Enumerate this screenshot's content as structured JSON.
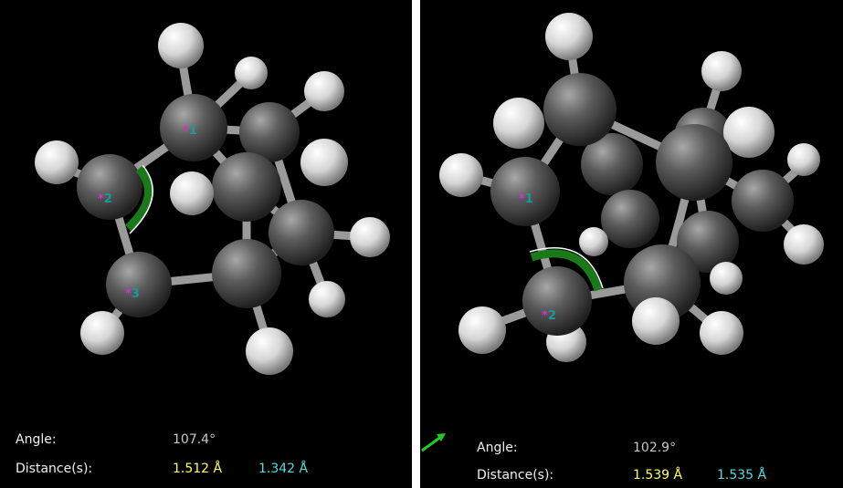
{
  "left_view": {
    "atom_labels": [
      "1",
      "2",
      "3"
    ],
    "angle_label": "Angle:",
    "angle_value": "107.4°",
    "distance_label": "Distance(s):",
    "distance_1": "1.512 Å",
    "distance_2": "1.342 Å"
  },
  "right_view": {
    "atom_labels": [
      "1",
      "2"
    ],
    "angle_label": "Angle:",
    "angle_value": "102.9°",
    "distance_label": "Distance(s):",
    "distance_1": "1.539 Å",
    "distance_2": "1.535 Å"
  },
  "colors": {
    "background": "#000000",
    "carbon": "#555555",
    "hydrogen": "#e0e0e0",
    "angle_arc": "#1a7a1a",
    "distance_1": "#ffff66",
    "distance_2": "#55dddd",
    "axis_arrow": "#22cc22"
  },
  "icons": [
    "axis-orientation-arrow-icon"
  ]
}
